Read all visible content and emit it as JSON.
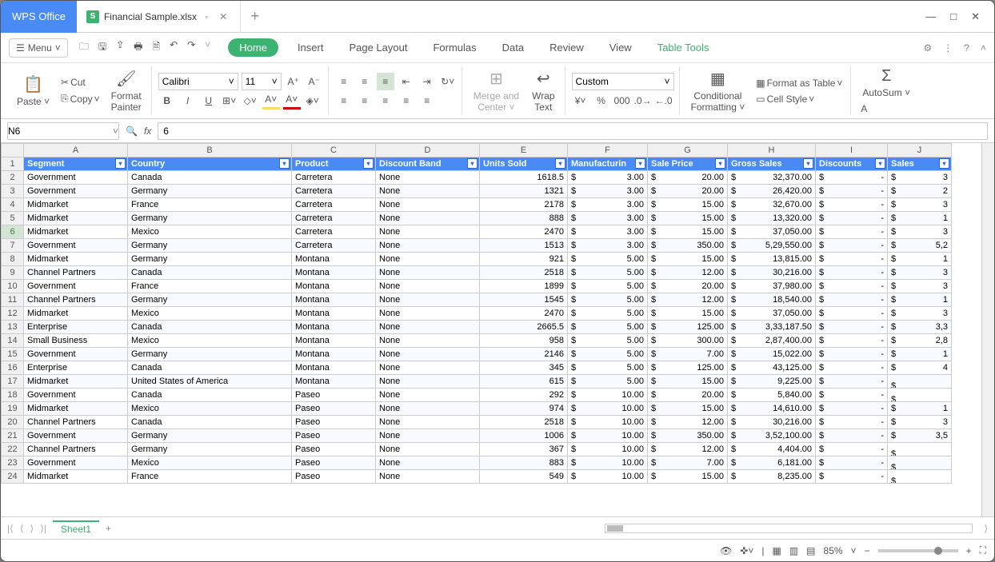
{
  "app": {
    "name": "WPS Office"
  },
  "file": {
    "name": "Financial Sample.xlsx",
    "modified": true
  },
  "menu": {
    "label": "Menu"
  },
  "tabs": {
    "home": "Home",
    "insert": "Insert",
    "pageLayout": "Page Layout",
    "formulas": "Formulas",
    "data": "Data",
    "review": "Review",
    "view": "View",
    "tableTools": "Table Tools"
  },
  "ribbon": {
    "paste": "Paste",
    "cut": "Cut",
    "copy": "Copy",
    "formatPainter": "Format Painter",
    "font": "Calibri",
    "size": "11",
    "merge": "Merge and Center",
    "wrap": "Wrap Text",
    "numberFormat": "Custom",
    "conditional": "Conditional Formatting",
    "formatTable": "Format as Table",
    "cellStyle": "Cell Style",
    "autosum": "AutoSum"
  },
  "namebox": "N6",
  "formula": "6",
  "columns": [
    "",
    "A",
    "B",
    "C",
    "D",
    "E",
    "F",
    "G",
    "H",
    "I",
    "J"
  ],
  "headers": [
    "Segment",
    "Country",
    "Product",
    "Discount Band",
    "Units Sold",
    "Manufacturin",
    "Sale Price",
    "Gross Sales",
    "Discounts",
    "Sales"
  ],
  "selectedRow": 6,
  "rows": [
    {
      "n": 2,
      "seg": "Government",
      "country": "Canada",
      "prod": "Carretera",
      "disc": "None",
      "units": "1618.5",
      "mfg": "3.00",
      "sale": "20.00",
      "gross": "32,370.00",
      "discounts": "-",
      "sales": "3"
    },
    {
      "n": 3,
      "seg": "Government",
      "country": "Germany",
      "prod": "Carretera",
      "disc": "None",
      "units": "1321",
      "mfg": "3.00",
      "sale": "20.00",
      "gross": "26,420.00",
      "discounts": "-",
      "sales": "2"
    },
    {
      "n": 4,
      "seg": "Midmarket",
      "country": "France",
      "prod": "Carretera",
      "disc": "None",
      "units": "2178",
      "mfg": "3.00",
      "sale": "15.00",
      "gross": "32,670.00",
      "discounts": "-",
      "sales": "3"
    },
    {
      "n": 5,
      "seg": "Midmarket",
      "country": "Germany",
      "prod": "Carretera",
      "disc": "None",
      "units": "888",
      "mfg": "3.00",
      "sale": "15.00",
      "gross": "13,320.00",
      "discounts": "-",
      "sales": "1"
    },
    {
      "n": 6,
      "seg": "Midmarket",
      "country": "Mexico",
      "prod": "Carretera",
      "disc": "None",
      "units": "2470",
      "mfg": "3.00",
      "sale": "15.00",
      "gross": "37,050.00",
      "discounts": "-",
      "sales": "3"
    },
    {
      "n": 7,
      "seg": "Government",
      "country": "Germany",
      "prod": "Carretera",
      "disc": "None",
      "units": "1513",
      "mfg": "3.00",
      "sale": "350.00",
      "gross": "5,29,550.00",
      "discounts": "-",
      "sales": "5,2"
    },
    {
      "n": 8,
      "seg": "Midmarket",
      "country": "Germany",
      "prod": "Montana",
      "disc": "None",
      "units": "921",
      "mfg": "5.00",
      "sale": "15.00",
      "gross": "13,815.00",
      "discounts": "-",
      "sales": "1"
    },
    {
      "n": 9,
      "seg": "Channel Partners",
      "country": "Canada",
      "prod": "Montana",
      "disc": "None",
      "units": "2518",
      "mfg": "5.00",
      "sale": "12.00",
      "gross": "30,216.00",
      "discounts": "-",
      "sales": "3"
    },
    {
      "n": 10,
      "seg": "Government",
      "country": "France",
      "prod": "Montana",
      "disc": "None",
      "units": "1899",
      "mfg": "5.00",
      "sale": "20.00",
      "gross": "37,980.00",
      "discounts": "-",
      "sales": "3"
    },
    {
      "n": 11,
      "seg": "Channel Partners",
      "country": "Germany",
      "prod": "Montana",
      "disc": "None",
      "units": "1545",
      "mfg": "5.00",
      "sale": "12.00",
      "gross": "18,540.00",
      "discounts": "-",
      "sales": "1"
    },
    {
      "n": 12,
      "seg": "Midmarket",
      "country": "Mexico",
      "prod": "Montana",
      "disc": "None",
      "units": "2470",
      "mfg": "5.00",
      "sale": "15.00",
      "gross": "37,050.00",
      "discounts": "-",
      "sales": "3"
    },
    {
      "n": 13,
      "seg": "Enterprise",
      "country": "Canada",
      "prod": "Montana",
      "disc": "None",
      "units": "2665.5",
      "mfg": "5.00",
      "sale": "125.00",
      "gross": "3,33,187.50",
      "discounts": "-",
      "sales": "3,3"
    },
    {
      "n": 14,
      "seg": "Small Business",
      "country": "Mexico",
      "prod": "Montana",
      "disc": "None",
      "units": "958",
      "mfg": "5.00",
      "sale": "300.00",
      "gross": "2,87,400.00",
      "discounts": "-",
      "sales": "2,8"
    },
    {
      "n": 15,
      "seg": "Government",
      "country": "Germany",
      "prod": "Montana",
      "disc": "None",
      "units": "2146",
      "mfg": "5.00",
      "sale": "7.00",
      "gross": "15,022.00",
      "discounts": "-",
      "sales": "1"
    },
    {
      "n": 16,
      "seg": "Enterprise",
      "country": "Canada",
      "prod": "Montana",
      "disc": "None",
      "units": "345",
      "mfg": "5.00",
      "sale": "125.00",
      "gross": "43,125.00",
      "discounts": "-",
      "sales": "4"
    },
    {
      "n": 17,
      "seg": "Midmarket",
      "country": "United States of America",
      "prod": "Montana",
      "disc": "None",
      "units": "615",
      "mfg": "5.00",
      "sale": "15.00",
      "gross": "9,225.00",
      "discounts": "-",
      "sales": ""
    },
    {
      "n": 18,
      "seg": "Government",
      "country": "Canada",
      "prod": "Paseo",
      "disc": "None",
      "units": "292",
      "mfg": "10.00",
      "sale": "20.00",
      "gross": "5,840.00",
      "discounts": "-",
      "sales": ""
    },
    {
      "n": 19,
      "seg": "Midmarket",
      "country": "Mexico",
      "prod": "Paseo",
      "disc": "None",
      "units": "974",
      "mfg": "10.00",
      "sale": "15.00",
      "gross": "14,610.00",
      "discounts": "-",
      "sales": "1"
    },
    {
      "n": 20,
      "seg": "Channel Partners",
      "country": "Canada",
      "prod": "Paseo",
      "disc": "None",
      "units": "2518",
      "mfg": "10.00",
      "sale": "12.00",
      "gross": "30,216.00",
      "discounts": "-",
      "sales": "3"
    },
    {
      "n": 21,
      "seg": "Government",
      "country": "Germany",
      "prod": "Paseo",
      "disc": "None",
      "units": "1006",
      "mfg": "10.00",
      "sale": "350.00",
      "gross": "3,52,100.00",
      "discounts": "-",
      "sales": "3,5"
    },
    {
      "n": 22,
      "seg": "Channel Partners",
      "country": "Germany",
      "prod": "Paseo",
      "disc": "None",
      "units": "367",
      "mfg": "10.00",
      "sale": "12.00",
      "gross": "4,404.00",
      "discounts": "-",
      "sales": ""
    },
    {
      "n": 23,
      "seg": "Government",
      "country": "Mexico",
      "prod": "Paseo",
      "disc": "None",
      "units": "883",
      "mfg": "10.00",
      "sale": "7.00",
      "gross": "6,181.00",
      "discounts": "-",
      "sales": ""
    },
    {
      "n": 24,
      "seg": "Midmarket",
      "country": "France",
      "prod": "Paseo",
      "disc": "None",
      "units": "549",
      "mfg": "10.00",
      "sale": "15.00",
      "gross": "8,235.00",
      "discounts": "-",
      "sales": ""
    }
  ],
  "sheetTab": "Sheet1",
  "zoom": "85%"
}
